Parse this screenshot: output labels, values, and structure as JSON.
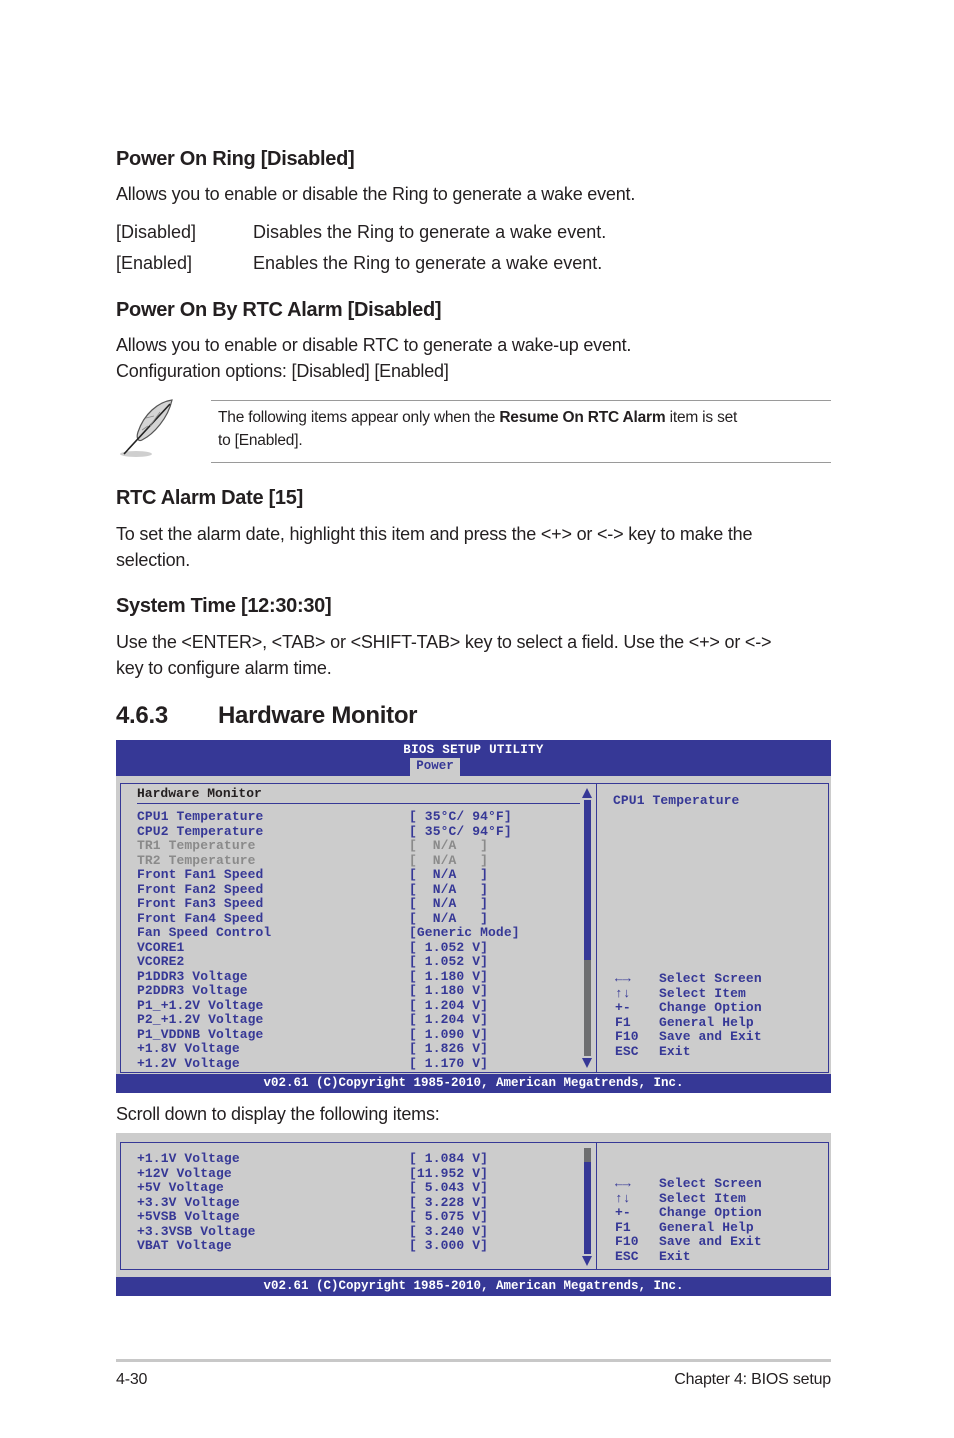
{
  "sections": {
    "power_on_ring": {
      "heading": "Power On Ring [Disabled]",
      "description": "Allows you to enable or disable the Ring to generate a wake event.",
      "options": [
        {
          "key": "[Disabled]",
          "desc": "Disables the Ring to generate a wake event."
        },
        {
          "key": "[Enabled]",
          "desc": "Enables the Ring to generate a wake event."
        }
      ]
    },
    "power_on_rtc": {
      "heading": "Power On By RTC Alarm [Disabled]",
      "line1": "Allows you to enable or disable RTC to generate a wake-up event.",
      "line2": "Configuration options: [Disabled] [Enabled]"
    },
    "note": {
      "icon": "feather-pen-icon",
      "text_before": "The following items appear only when the ",
      "text_bold": "Resume On RTC Alarm",
      "text_after": " item is set",
      "text_line2": "to [Enabled]."
    },
    "rtc_alarm_date": {
      "heading": "RTC Alarm Date [15]",
      "line1": "To set the alarm date, highlight this item and press the <+> or <-> key to make the",
      "line2": "selection."
    },
    "system_time": {
      "heading": "System Time [12:30:30]",
      "line1": "Use the <ENTER>, <TAB> or <SHIFT-TAB> key to select a field. Use the <+> or <->",
      "line2": "key to configure alarm time."
    },
    "hardware_monitor": {
      "number": "4.6.3",
      "title": "Hardware Monitor"
    },
    "scroll_note": "Scroll down to display the following items:"
  },
  "bios1": {
    "title": "BIOS SETUP UTILITY",
    "active_tab": "Power",
    "section_title": "Hardware Monitor",
    "scroll_position": 0,
    "items": [
      {
        "label": "CPU1 Temperature",
        "value": "[ 35°C/ 94°F]",
        "dim": false
      },
      {
        "label": "CPU2 Temperature",
        "value": "[ 35°C/ 94°F]",
        "dim": false
      },
      {
        "label": "TR1 Temperature",
        "value": "[  N/A   ]",
        "dim": true
      },
      {
        "label": "TR2 Temperature",
        "value": "[  N/A   ]",
        "dim": true
      },
      {
        "label": "Front Fan1 Speed",
        "value": "[  N/A   ]",
        "dim": false
      },
      {
        "label": "Front Fan2 Speed",
        "value": "[  N/A   ]",
        "dim": false
      },
      {
        "label": "Front Fan3 Speed",
        "value": "[  N/A   ]",
        "dim": false
      },
      {
        "label": "Front Fan4 Speed",
        "value": "[  N/A   ]",
        "dim": false
      },
      {
        "label": "Fan Speed Control",
        "value": "[Generic Mode]",
        "dim": false
      },
      {
        "label": "VCORE1",
        "value": "[ 1.052 V]",
        "dim": false
      },
      {
        "label": "VCORE2",
        "value": "[ 1.052 V]",
        "dim": false
      },
      {
        "label": "P1DDR3 Voltage",
        "value": "[ 1.180 V]",
        "dim": false
      },
      {
        "label": "P2DDR3 Voltage",
        "value": "[ 1.180 V]",
        "dim": false
      },
      {
        "label": "P1_+1.2V Voltage",
        "value": "[ 1.204 V]",
        "dim": false
      },
      {
        "label": "P2_+1.2V Voltage",
        "value": "[ 1.204 V]",
        "dim": false
      },
      {
        "label": "P1_VDDNB Voltage",
        "value": "[ 1.090 V]",
        "dim": false
      },
      {
        "label": "+1.8V Voltage",
        "value": "[ 1.826 V]",
        "dim": false
      },
      {
        "label": "+1.2V Voltage",
        "value": "[ 1.170 V]",
        "dim": false
      }
    ],
    "help_title": "CPU1 Temperature",
    "help": [
      {
        "key": "←→",
        "desc": "Select Screen"
      },
      {
        "key": "↑↓",
        "desc": "Select Item"
      },
      {
        "key": "+-",
        "desc": "Change Option"
      },
      {
        "key": "F1",
        "desc": "General Help"
      },
      {
        "key": "F10",
        "desc": "Save and Exit"
      },
      {
        "key": "ESC",
        "desc": "Exit"
      }
    ],
    "footer": "v02.61 (C)Copyright 1985-2010, American Megatrends, Inc."
  },
  "bios2": {
    "scroll_position": 1,
    "items": [
      {
        "label": "+1.1V Voltage",
        "value": "[ 1.084 V]"
      },
      {
        "label": "+12V Voltage",
        "value": "[11.952 V]"
      },
      {
        "label": "+5V Voltage",
        "value": "[ 5.043 V]"
      },
      {
        "label": "+3.3V Voltage",
        "value": "[ 3.228 V]"
      },
      {
        "label": "+5VSB Voltage",
        "value": "[ 5.075 V]"
      },
      {
        "label": "+3.3VSB Voltage",
        "value": "[ 3.240 V]"
      },
      {
        "label": "VBAT Voltage",
        "value": "[ 3.000 V]"
      }
    ],
    "help": [
      {
        "key": "←→",
        "desc": "Select Screen"
      },
      {
        "key": "↑↓",
        "desc": "Select Item"
      },
      {
        "key": "+-",
        "desc": "Change Option"
      },
      {
        "key": "F1",
        "desc": "General Help"
      },
      {
        "key": "F10",
        "desc": "Save and Exit"
      },
      {
        "key": "ESC",
        "desc": "Exit"
      }
    ],
    "footer": "v02.61 (C)Copyright 1985-2010, American Megatrends, Inc."
  },
  "page_footer": {
    "page_number": "4-30",
    "chapter": "Chapter 4: BIOS setup"
  }
}
